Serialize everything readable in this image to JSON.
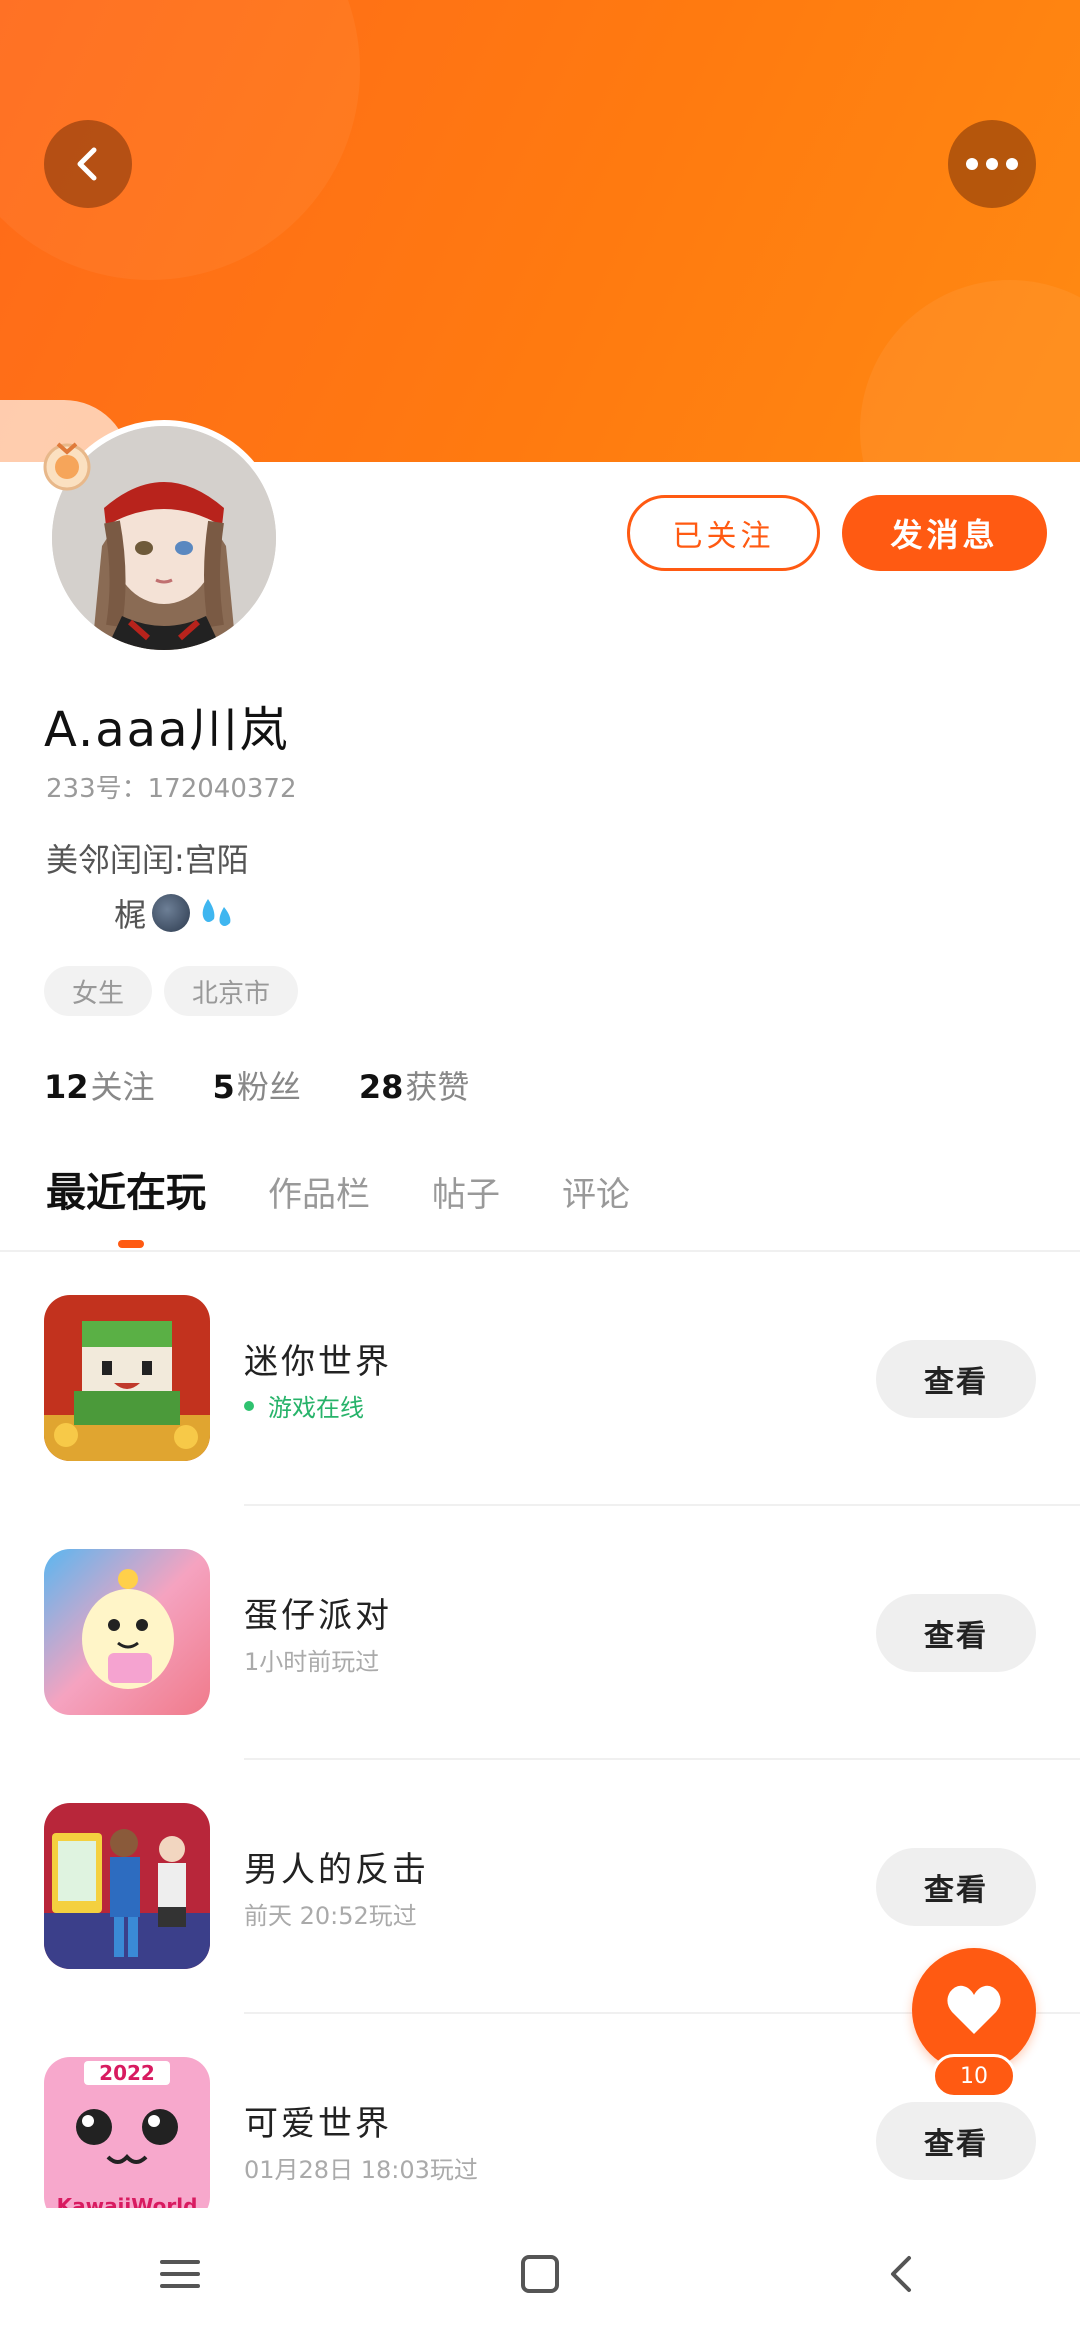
{
  "header": {
    "back_icon": "chevron-left-icon",
    "more_icon": "more-horizontal-icon"
  },
  "profile": {
    "username": "A.aaa川岚",
    "uid": "233号：172040372",
    "bio_line1": "美邻闰闰:宫陌",
    "bio_line2": "梶",
    "follow_button": "已关注",
    "message_button": "发消息",
    "tags": [
      "女生",
      "北京市"
    ],
    "stats": [
      {
        "num": "12",
        "label": "关注"
      },
      {
        "num": "5",
        "label": "粉丝"
      },
      {
        "num": "28",
        "label": "获赞"
      }
    ]
  },
  "tabs": [
    "最近在玩",
    "作品栏",
    "帖子",
    "评论"
  ],
  "active_tab": 0,
  "games": [
    {
      "title": "迷你世界",
      "status": "游戏在线",
      "online": true,
      "action": "查看"
    },
    {
      "title": "蛋仔派对",
      "status": "1小时前玩过",
      "online": false,
      "action": "查看"
    },
    {
      "title": "男人的反击",
      "status": "前天 20:52玩过",
      "online": false,
      "action": "查看"
    },
    {
      "title": "可爱世界",
      "status": "01月28日 18:03玩过",
      "online": false,
      "action": "查看"
    }
  ],
  "game_icon_texts": {
    "kawaii_year": "2022",
    "kawaii_name": "KawaiiWorld"
  },
  "fab": {
    "icon": "heart-icon",
    "count": "10"
  },
  "colors": {
    "accent": "#ff5a12",
    "banner": "#ff7a10",
    "online": "#27b36a"
  }
}
